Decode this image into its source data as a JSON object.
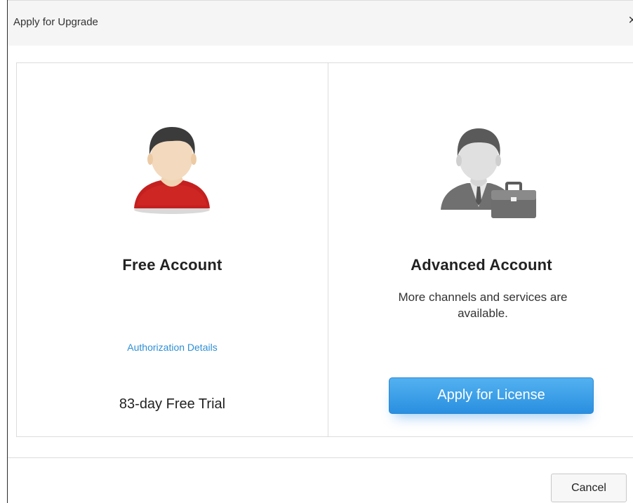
{
  "dialog": {
    "title": "Apply for Upgrade",
    "close_glyph": "×"
  },
  "free_account": {
    "icon": "user-red-shirt-icon",
    "title": "Free Account",
    "link": "Authorization Details",
    "trial": "83-day Free Trial"
  },
  "advanced_account": {
    "icon": "businessman-briefcase-icon",
    "title": "Advanced Account",
    "description": "More channels and services are available.",
    "button": "Apply for License"
  },
  "footer": {
    "cancel": "Cancel"
  },
  "colors": {
    "accent": "#2d8fd5",
    "button_blue": "#3a9ee8",
    "shirt_red": "#c4201f"
  }
}
